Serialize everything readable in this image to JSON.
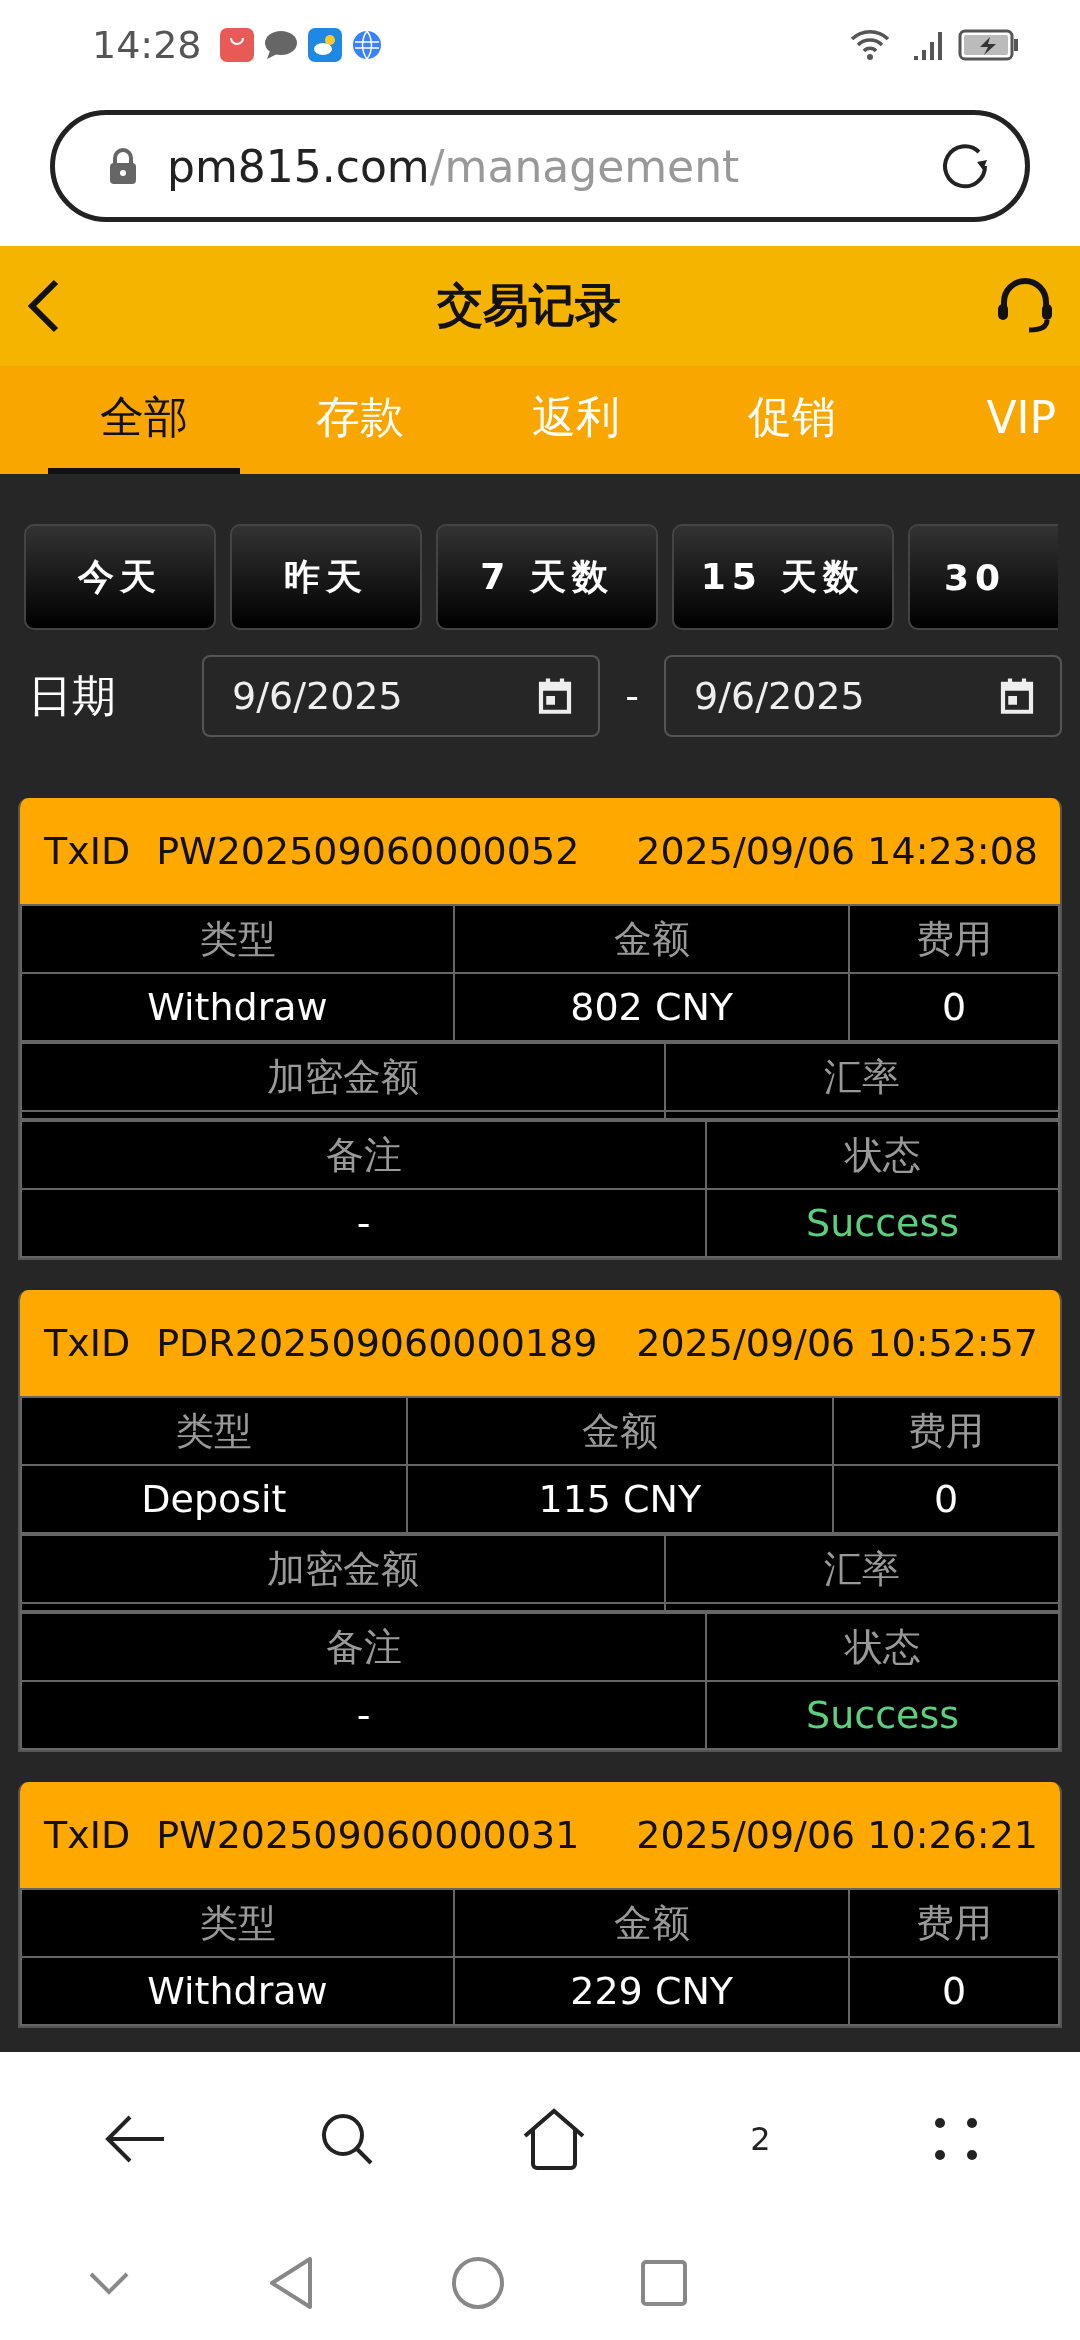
{
  "status_bar": {
    "time": "14:28"
  },
  "browser": {
    "url_domain": "pm815.com",
    "url_path": "/management",
    "tab_count": "2"
  },
  "header": {
    "title": "交易记录"
  },
  "tabs": [
    {
      "label": "全部",
      "selected": true
    },
    {
      "label": "存款",
      "selected": false
    },
    {
      "label": "返利",
      "selected": false
    },
    {
      "label": "促销",
      "selected": false
    },
    {
      "label": "VIP",
      "selected": false
    }
  ],
  "quick_ranges": [
    "今天",
    "昨天",
    "7 天数",
    "15 天数",
    "30"
  ],
  "date_filter": {
    "label": "日期",
    "from": "9/6/2025",
    "separator": "-",
    "to": "9/6/2025"
  },
  "transactions": [
    {
      "txid_label": "TxID",
      "txid": "PW202509060000052",
      "time": "2025/09/06 14:23:08",
      "type_label": "类型",
      "amount_label": "金额",
      "fee_label": "费用",
      "type": "Withdraw",
      "amount": "802 CNY",
      "fee": "0",
      "crypto_label": "加密金额",
      "rate_label": "汇率",
      "note_label": "备注",
      "status_label": "状态",
      "note": "-",
      "status": "Success"
    },
    {
      "txid_label": "TxID",
      "txid": "PDR202509060000189",
      "time": "2025/09/06 10:52:57",
      "type_label": "类型",
      "amount_label": "金额",
      "fee_label": "费用",
      "type": "Deposit",
      "amount": "115 CNY",
      "fee": "0",
      "crypto_label": "加密金额",
      "rate_label": "汇率",
      "note_label": "备注",
      "status_label": "状态",
      "note": "-",
      "status": "Success"
    },
    {
      "txid_label": "TxID",
      "txid": "PW202509060000031",
      "time": "2025/09/06 10:26:21",
      "type_label": "类型",
      "amount_label": "金额",
      "fee_label": "费用",
      "type": "Withdraw",
      "amount": "229 CNY",
      "fee": "0"
    }
  ]
}
